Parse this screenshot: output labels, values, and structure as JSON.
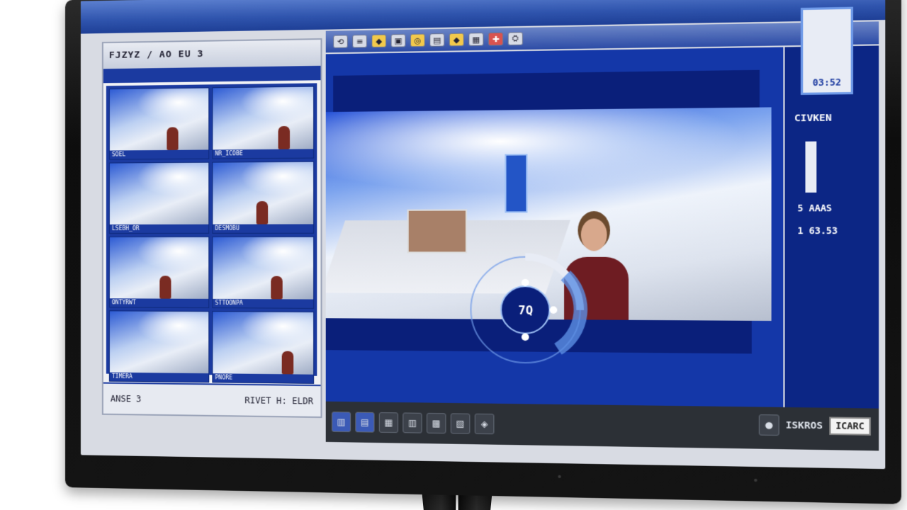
{
  "left_panel": {
    "header": "FJZYZ / AO EU 3",
    "footer_left": "ANSE 3",
    "footer_right": "RIVET H: ELDR",
    "thumbnails": [
      {
        "caption": "SOEL"
      },
      {
        "caption": "NR_ICOBE"
      },
      {
        "caption": "LSEBH_OR"
      },
      {
        "caption": "DESMOBU"
      },
      {
        "caption": "ONTYRWT"
      },
      {
        "caption": "STTOONPA"
      },
      {
        "caption": "TIMERA"
      },
      {
        "caption": "PNORE"
      }
    ]
  },
  "toolbar": {
    "buttons": [
      "⟲",
      "≡",
      "◆",
      "▣",
      "◎",
      "▤",
      "◆",
      "▦",
      "✚",
      "⛭"
    ]
  },
  "main": {
    "dial_label": "7Q"
  },
  "info": {
    "top_value": "03:52",
    "title": "CIVKEN",
    "line1": "5 AAAS",
    "line2": "1 63.53"
  },
  "bottom": {
    "buttons": [
      "▥",
      "▤",
      "▦",
      "▥",
      "▩",
      "▧",
      "◈"
    ],
    "label": "ISKROS",
    "badge": "ICARC"
  }
}
